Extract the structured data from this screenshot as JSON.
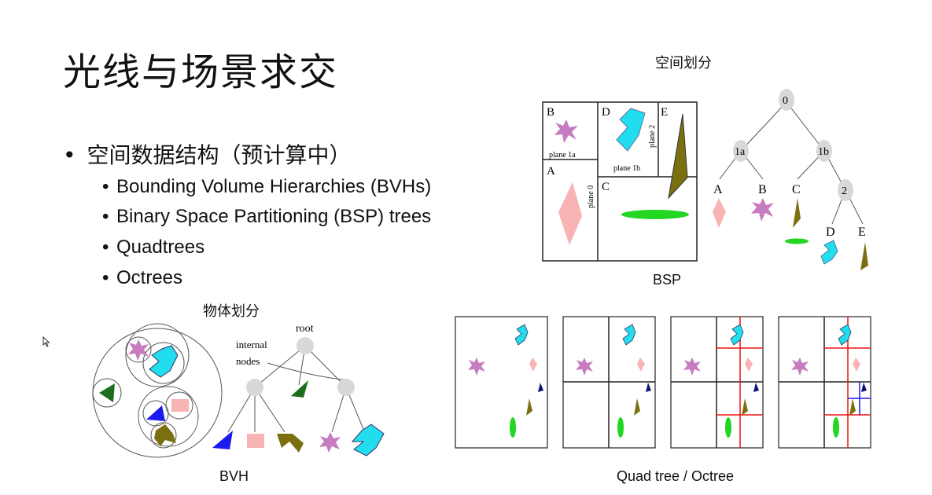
{
  "slide": {
    "title": "光线与场景求交",
    "bullet_main": "空间数据结构（预计算中）",
    "bullet_subs": [
      "Bounding Volume Hierarchies (BVHs)",
      "Binary Space Partitioning (BSP) trees",
      "Quadtrees",
      "Octrees"
    ]
  },
  "bsp_figure": {
    "heading": "空间划分",
    "caption": "BSP",
    "region_labels": [
      "A",
      "B",
      "C",
      "D",
      "E"
    ],
    "plane_labels": [
      "plane 1a",
      "plane 0",
      "plane 1b",
      "plane 2"
    ],
    "tree_nodes": [
      "0",
      "1a",
      "1b",
      "2"
    ],
    "tree_leaves": [
      "A",
      "B",
      "C",
      "D",
      "E"
    ]
  },
  "bvh_figure": {
    "heading": "物体划分",
    "caption": "BVH",
    "labels": {
      "root": "root",
      "internal": "internal",
      "nodes": "nodes"
    }
  },
  "quad_figure": {
    "caption": "Quad tree / Octree"
  },
  "colors": {
    "star": "#c77cc0",
    "cyan": "#22ddee",
    "pink": "#f8b4b4",
    "olive": "#7a7010",
    "green": "#22d622",
    "darkgreen": "#1e6e1e",
    "blue": "#1a1aee",
    "navy": "#101070",
    "node": "#d8d8d8",
    "red": "#ee1111"
  }
}
